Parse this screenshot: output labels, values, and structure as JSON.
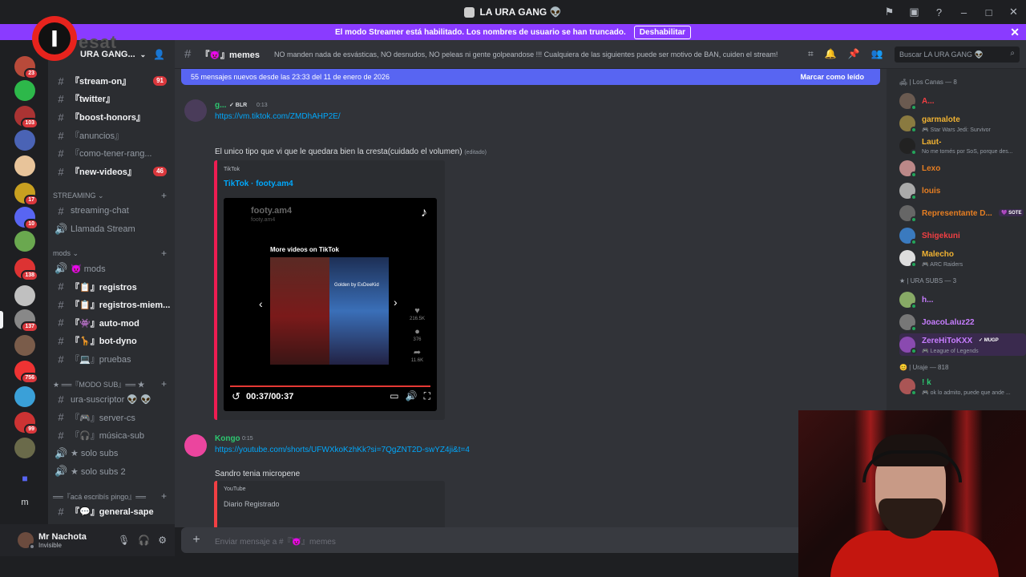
{
  "titlebar": {
    "title": "LA URA GANG 👽"
  },
  "banner": {
    "text": "El modo Streamer está habilitado. Los nombres de usuario se han truncado.",
    "button": "Deshabilitar"
  },
  "logo": {
    "letter": "I",
    "text": "esat"
  },
  "server": {
    "name": "URA GANG..."
  },
  "servers": [
    {
      "badge": "23",
      "color": "#b84a3a"
    },
    {
      "badge": "",
      "color": "#2db84a"
    },
    {
      "badge": "103",
      "color": "#a33"
    },
    {
      "badge": "",
      "color": "#4a63b5"
    },
    {
      "badge": "",
      "color": "#e8c49a"
    },
    {
      "badge": "17",
      "color": "#c8a020"
    },
    {
      "badge": "10",
      "color": "#5865f2"
    },
    {
      "badge": "",
      "color": "#6aa84f"
    },
    {
      "badge": "138",
      "color": "#d33"
    },
    {
      "badge": "",
      "color": "#c0c0c0"
    },
    {
      "badge": "137",
      "color": "#888"
    },
    {
      "badge": "",
      "color": "#7a5c4a"
    },
    {
      "badge": "756",
      "color": "#e33"
    },
    {
      "badge": "",
      "color": "#3aa0d8"
    },
    {
      "badge": "99",
      "color": "#c33"
    },
    {
      "badge": "",
      "color": "#6a6a4a"
    }
  ],
  "rail_bottom": {
    "m_label": "m"
  },
  "channels": [
    {
      "name": "『stream-on』",
      "unread": true,
      "count": "91",
      "arrow": "▸",
      "prefix": "» 📺 "
    },
    {
      "name": "『twitter』",
      "unread": true,
      "count": "",
      "arrow": "▸",
      "prefix": "» ✗ "
    },
    {
      "name": "『boost-honors』",
      "unread": true,
      "count": "",
      "arrow": "▸",
      "prefix": "» 💜 "
    },
    {
      "name": "『anuncios』",
      "unread": false,
      "count": "",
      "arrow": "",
      "prefix": "» 🔔 "
    },
    {
      "name": "『como-tener-rang...",
      "unread": false,
      "count": "",
      "arrow": "",
      "prefix": "» ╱ "
    },
    {
      "name": "『new-videos』",
      "unread": true,
      "count": "46",
      "arrow": "▸",
      "prefix": "» 🎞 "
    }
  ],
  "cat_streaming": "STREAMING ⌄",
  "streaming_channels": [
    {
      "name": "streaming-chat",
      "icon": "#"
    },
    {
      "name": "Llamada Stream",
      "icon": "🔊"
    }
  ],
  "cat_mods": "mods ⌄",
  "mods_channels": [
    {
      "name": "😈 mods",
      "unread": false,
      "arrow": "",
      "icon": "🔊"
    },
    {
      "name": "『📋』registros",
      "unread": true,
      "arrow": "▸",
      "icon": "#"
    },
    {
      "name": "『📋』registros-miem...",
      "unread": true,
      "arrow": "▸",
      "icon": "#"
    },
    {
      "name": "『👾』auto-mod",
      "unread": true,
      "arrow": "▸",
      "icon": "#"
    },
    {
      "name": "『🦒』bot-dyno",
      "unread": true,
      "arrow": "▸",
      "icon": "#"
    },
    {
      "name": "『💻』pruebas",
      "unread": false,
      "arrow": "",
      "icon": "#"
    }
  ],
  "cat_sub": "★ ══『MODO SUB』══ ★",
  "sub_channels": [
    {
      "name": "ura-suscriptor 👽 👽",
      "icon": "#"
    },
    {
      "name": "『🎮』server-cs",
      "icon": "#"
    },
    {
      "name": "『🎧』música-sub",
      "icon": "#"
    },
    {
      "name": "★ solo subs",
      "icon": "🔊"
    },
    {
      "name": "★ solo subs 2",
      "icon": "🔊"
    }
  ],
  "cat_pingo": "══『acá escribís pingo』══",
  "pingo_channels": [
    {
      "name": "『💬』general-sape",
      "icon": "#"
    }
  ],
  "user": {
    "name": "Mr Nachota",
    "status": "Invisible"
  },
  "chat": {
    "channel": "『😈』memes",
    "topic": "NO manden nada de esvásticas, NO desnudos, NO peleas ni gente golpeandose !!! Cualquiera de las siguientes puede ser motivo de BAN, cuiden el stream!",
    "search_placeholder": "Buscar LA URA GANG 👽",
    "new_messages": "55 mensajes nuevos desde las 23:33 del 11 de enero de 2026",
    "mark_read": "Marcar como leído"
  },
  "messages": [
    {
      "author": "g...",
      "tag": "✓ BLR",
      "time": "0:13",
      "author_color": "#2dc770",
      "link": "https://vm.tiktok.com/ZMDhAHP2E/",
      "text": "El unico tipo que vi que le quedara bien la cresta(cuidado el volumen)",
      "edited": "(editado)",
      "embed": {
        "provider": "TikTok",
        "title": "TikTok · footy.am4"
      }
    },
    {
      "author": "Kongo",
      "time": "0:15",
      "author_color": "#2dc770",
      "link": "https://youtube.com/shorts/UFWXkoKzhKk?si=7QgZNT2D-swYZ4ji&t=4",
      "text": "Sandro tenia micropene",
      "embed": {
        "provider": "YouTube",
        "title": "Diario Registrado"
      }
    }
  ],
  "video": {
    "user": "footy.am4",
    "user2": "footy.am4",
    "more": "More videos on TikTok",
    "thumb_caption": "Golden by ExDeeKid",
    "likes": "216.5K",
    "comments": "376",
    "shares": "11.6K",
    "time": "00:37/00:37"
  },
  "composer": {
    "placeholder": "Enviar mensaje a #『😈』memes"
  },
  "members": {
    "groups": [
      {
        "label": "🛋 | Los Canas — 8",
        "items": [
          {
            "name": "A...",
            "color": "#f23f43",
            "activity": ""
          },
          {
            "name": "garmalote",
            "color": "#f0b232",
            "activity": "🎮 Star Wars Jedi: Survivor"
          },
          {
            "name": "Laut-",
            "color": "#f0b232",
            "activity": "No me tomés por SoS, porque des..."
          },
          {
            "name": "Lexo",
            "color": "#e67e22",
            "activity": ""
          },
          {
            "name": "louis",
            "color": "#e67e22",
            "activity": ""
          },
          {
            "name": "Representante D...",
            "color": "#e67e22",
            "activity": "",
            "tag": "💜 SOTE"
          },
          {
            "name": "Shigekuni",
            "color": "#f23f43",
            "activity": ""
          },
          {
            "name": "Malecho",
            "color": "#f0b232",
            "activity": "🎮 ARC Raiders"
          }
        ]
      },
      {
        "label": "★ | URA SUBS — 3",
        "items": [
          {
            "name": "h...",
            "color": "#c77dff",
            "activity": ""
          },
          {
            "name": "JoacoLaluz22",
            "color": "#c77dff",
            "activity": ""
          },
          {
            "name": "ZereHiToKXX",
            "color": "#c77dff",
            "activity": "🎮 League of Legends",
            "tag": "✓ MUGP"
          }
        ]
      },
      {
        "label": "😊 | Uraje — 818",
        "items": [
          {
            "name": "! k",
            "color": "#2dc770",
            "activity": "🎮 ok lo admito, puede que ande ..."
          }
        ]
      }
    ]
  },
  "colors": {
    "accent": "#5865f2",
    "banner": "#8a3bff",
    "link": "#00a8fc",
    "tiktok": "#ee1d52"
  }
}
